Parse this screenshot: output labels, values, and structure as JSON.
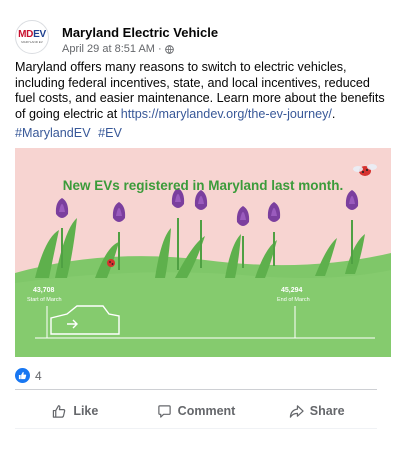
{
  "post": {
    "page_name": "Maryland Electric Vehicle",
    "timestamp": "April 29 at 8:51 AM",
    "separator": "·",
    "audience_icon": "globe-icon",
    "avatar_logo": {
      "part1": "MD",
      "part2": "EV",
      "tagline": "MARYLAND EV"
    },
    "body_text": "Maryland offers many reasons to switch to electric vehicles, including federal incentives, state, and local incentives, reduced fuel costs, and easier maintenance. Learn more about the benefits of going electric at ",
    "link_text": "https://marylandev.org/the-ev-journey/",
    "body_end": ".",
    "hashtags": [
      "#MarylandEV",
      "#EV"
    ]
  },
  "image": {
    "headline": "New EVs registered in Maryland last month.",
    "start": {
      "value": "43,708",
      "label": "Start of March"
    },
    "end": {
      "value": "45,294",
      "label": "End of March"
    },
    "colors": {
      "sky": "#f7d4d1",
      "grass": "#7fc769",
      "grass_dark": "#5eb04c",
      "headline": "#3b9b3a",
      "flower": "#7b3f9e"
    }
  },
  "reactions": {
    "icon": "thumbs-up-icon",
    "count": "4"
  },
  "actions": [
    {
      "label": "Like",
      "icon": "thumbs-up-outline-icon"
    },
    {
      "label": "Comment",
      "icon": "comment-icon"
    },
    {
      "label": "Share",
      "icon": "share-icon"
    }
  ],
  "colors": {
    "link": "#385898",
    "meta": "#65676b",
    "like_blue": "#1877f2"
  }
}
